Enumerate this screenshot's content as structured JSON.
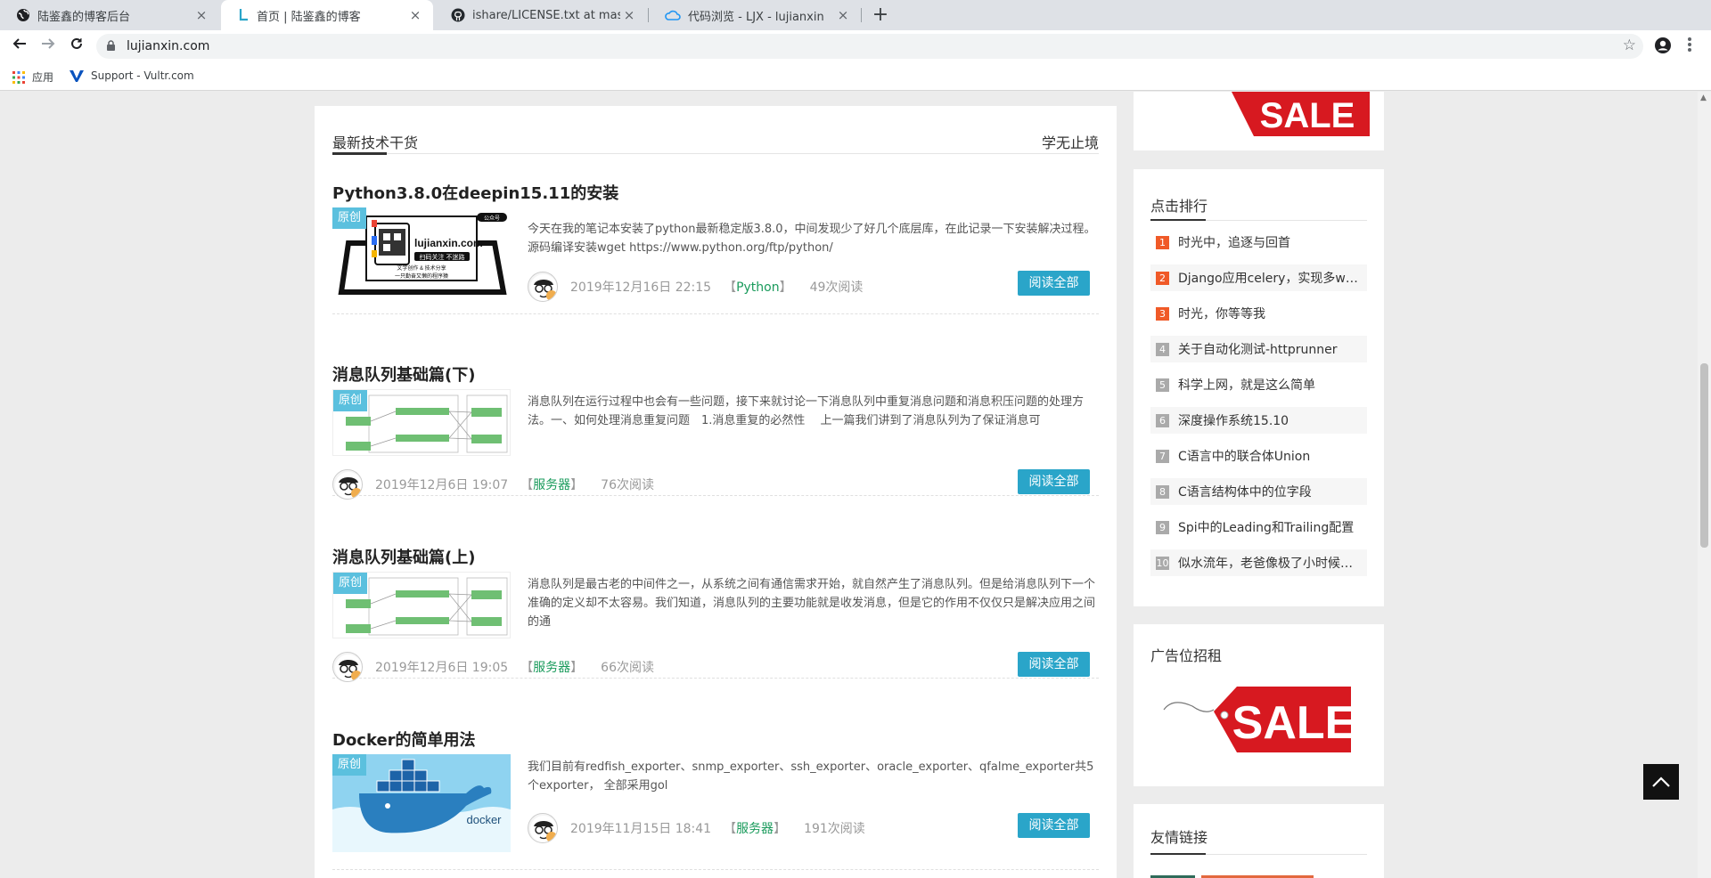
{
  "browser": {
    "tabs": [
      {
        "title": "陆鉴鑫的博客后台",
        "icon": "globe-icon",
        "close": "×"
      },
      {
        "title": "首页 | 陆鉴鑫的博客",
        "icon": "site-l-icon",
        "close": "×"
      },
      {
        "title": "ishare/LICENSE.txt at master",
        "icon": "github-icon",
        "close": "×"
      },
      {
        "title": "代码浏览 - LJX - lujianxin",
        "icon": "cloud-icon",
        "close": "×"
      }
    ],
    "new_tab": "+",
    "url": "lujianxin.com",
    "bookmarks": [
      {
        "label": "应用",
        "icon": "apps-grid-icon"
      },
      {
        "label": "Support - Vultr.com",
        "icon": "vultr-icon"
      }
    ]
  },
  "main": {
    "section_title": "最新技术干货",
    "section_right": "学无止境",
    "articles": [
      {
        "title": "Python3.8.0在deepin15.11的安装",
        "badge": "原创",
        "thumb_text_1": "lujianxin.com",
        "thumb_text_2": "扫码关注 不迷路",
        "thumb_text_3": "文学创作 & 技术分享",
        "thumb_text_4": "一只勤奋又懒的程序猿",
        "thumb_tag": "公众号",
        "excerpt": "今天在我的笔记本安装了python最新稳定版3.8.0，中间发现少了好几个底层库，在此记录一下安装解决过程。 源码编译安装wget https://www.python.org/ftp/python/",
        "date": "2019年12月16日 22:15",
        "category": "Python",
        "views": "49次阅读",
        "read_more": "阅读全部"
      },
      {
        "title": "消息队列基础篇(下)",
        "badge": "原创",
        "excerpt": "消息队列在运行过程中也会有一些问题，接下来就讨论一下消息队列中重复消息问题和消息积压问题的处理方法。一、如何处理消息重复问题　1.消息重复的必然性　 上一篇我们讲到了消息队列为了保证消息可",
        "date": "2019年12月6日 19:07",
        "category": "服务器",
        "views": "76次阅读",
        "read_more": "阅读全部"
      },
      {
        "title": "消息队列基础篇(上)",
        "badge": "原创",
        "excerpt": "消息队列是最古老的中间件之一，从系统之间有通信需求开始，就自然产生了消息队列。但是给消息队列下一个准确的定义却不太容易。我们知道，消息队列的主要功能就是收发消息，但是它的作用不仅仅只是解决应用之间的通",
        "date": "2019年12月6日 19:05",
        "category": "服务器",
        "views": "66次阅读",
        "read_more": "阅读全部"
      },
      {
        "title": "Docker的简单用法",
        "badge": "原创",
        "thumb_text": "docker",
        "excerpt": "我们目前有redfish_exporter、snmp_exporter、ssh_exporter、oracle_exporter、qfalme_exporter共5个exporter， 全部采用gol",
        "date": "2019年11月15日 18:41",
        "category": "服务器",
        "views": "191次阅读",
        "read_more": "阅读全部"
      }
    ]
  },
  "sidebar": {
    "sale_text": "SALE",
    "ranking_title": "点击排行",
    "ranking": [
      {
        "num": "1",
        "label": "时光中，追逐与回首",
        "color": "#f05a28"
      },
      {
        "num": "2",
        "label": "Django应用celery，实现多w…",
        "color": "#f05a28"
      },
      {
        "num": "3",
        "label": "时光，你等等我",
        "color": "#f05a28"
      },
      {
        "num": "4",
        "label": "关于自动化测试-httprunner",
        "color": "#aaaaaa"
      },
      {
        "num": "5",
        "label": "科学上网，就是这么简单",
        "color": "#aaaaaa"
      },
      {
        "num": "6",
        "label": "深度操作系统15.10",
        "color": "#aaaaaa"
      },
      {
        "num": "7",
        "label": "C语言中的联合体Union",
        "color": "#aaaaaa"
      },
      {
        "num": "8",
        "label": "C语言结构体中的位字段",
        "color": "#aaaaaa"
      },
      {
        "num": "9",
        "label": "Spi中的Leading和Trailing配置",
        "color": "#aaaaaa"
      },
      {
        "num": "10",
        "label": "似水流年，老爸像极了小时候…",
        "color": "#aaaaaa"
      }
    ],
    "ad_title": "广告位招租",
    "links_title": "友情链接"
  },
  "colors": {
    "accent": "#2aa5c9",
    "badge": "#5bc0de",
    "category": "#1a9b5c",
    "rank_top": "#f05a28",
    "sale_red": "#d71920"
  }
}
